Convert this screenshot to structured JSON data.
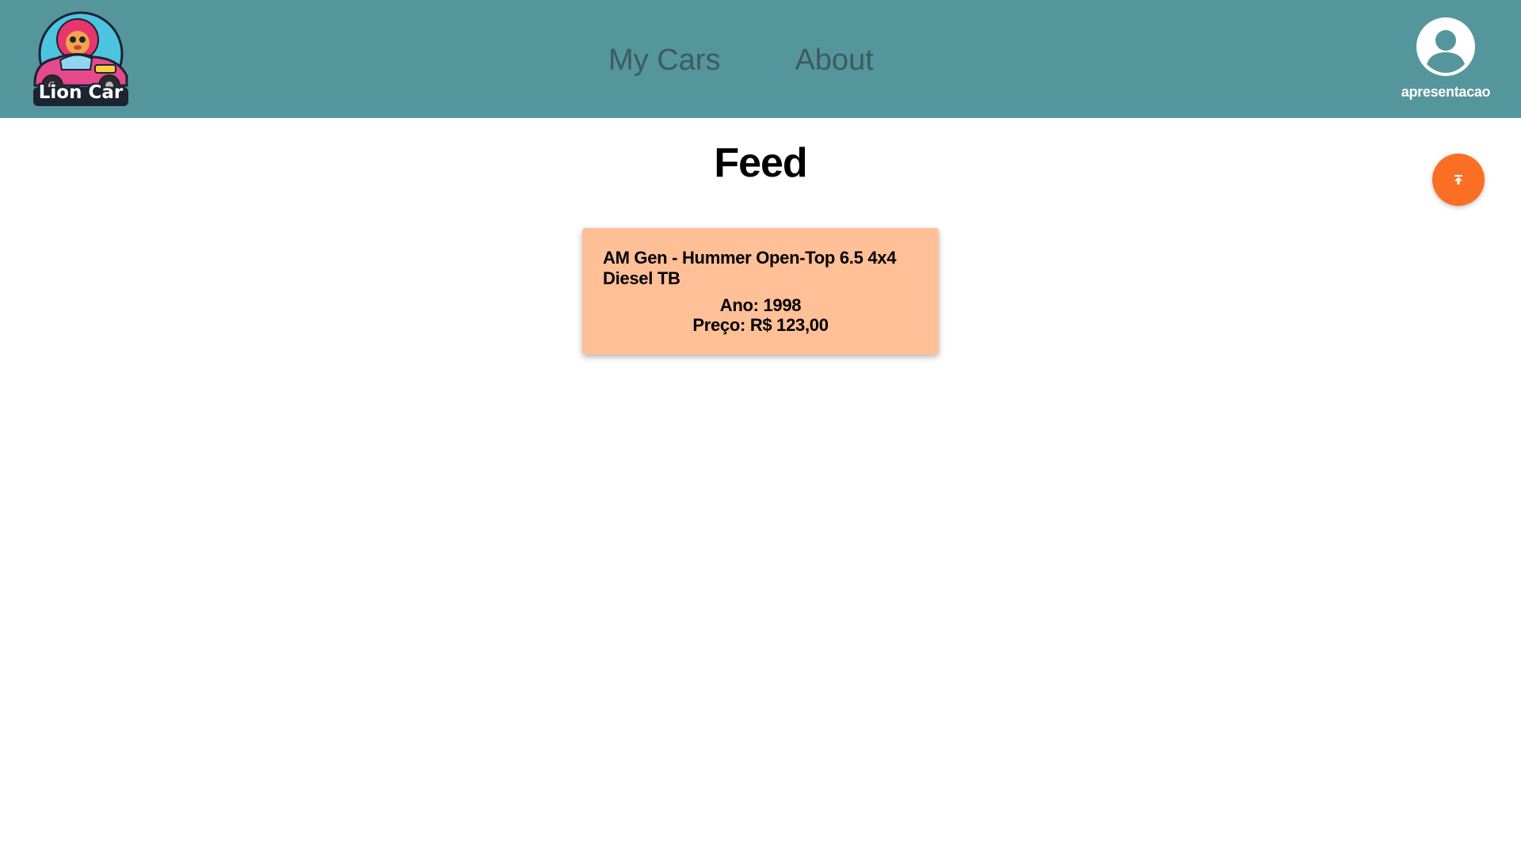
{
  "colors": {
    "navbar": "#55969d",
    "nav_link": "#3d5c60",
    "fab": "#fb6f24",
    "card": "#ffbf97"
  },
  "brand": {
    "logo_text": "Lion Car",
    "logo_icon": "lion-car-logo-icon"
  },
  "nav": {
    "links": [
      {
        "label": "My Cars"
      },
      {
        "label": "About"
      }
    ]
  },
  "user": {
    "icon": "user-avatar-icon",
    "name": "apresentacao"
  },
  "page": {
    "title": "Feed"
  },
  "fab": {
    "icon": "upload-icon"
  },
  "feed": {
    "cars": [
      {
        "title": "AM Gen - Hummer Open-Top 6.5 4x4 Diesel TB",
        "year": "Ano: 1998",
        "price": "Preço: R$ 123,00"
      }
    ]
  }
}
